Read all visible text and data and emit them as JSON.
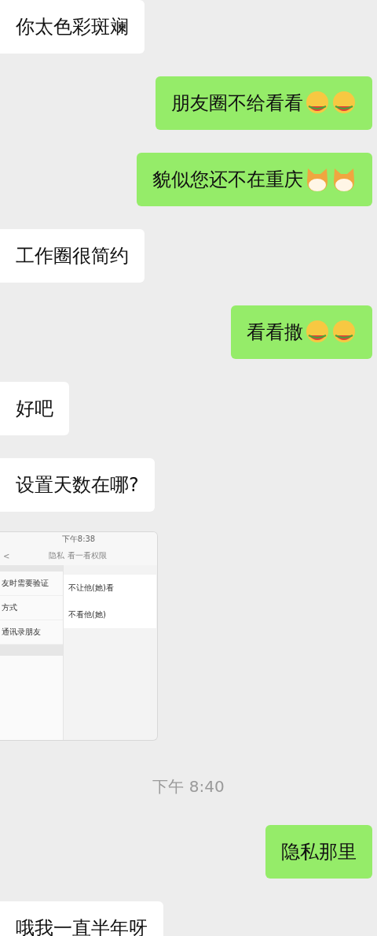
{
  "messages": [
    {
      "kind": "received",
      "text": "你太色彩斑斓"
    },
    {
      "kind": "sent",
      "text": "朋友圈不给看看",
      "stickers": [
        {
          "kind": "melon"
        },
        {
          "kind": "melon"
        }
      ]
    },
    {
      "kind": "sent",
      "text": "貌似您还不在重庆",
      "stickers": [
        {
          "kind": "dog"
        },
        {
          "kind": "dog"
        }
      ]
    },
    {
      "kind": "received",
      "text": "工作圈很简约"
    },
    {
      "kind": "sent",
      "text": "看看撒",
      "stickers": [
        {
          "kind": "melon"
        },
        {
          "kind": "melon"
        }
      ]
    },
    {
      "kind": "received",
      "text": "好吧"
    },
    {
      "kind": "received",
      "text": "设置天数在哪?"
    },
    {
      "kind": "screenshot",
      "status_time": "下午8:38",
      "title": "隐私 看一看权限",
      "back": "<",
      "list": [
        "友时需要验证",
        "方式",
        "通讯录朋友"
      ],
      "menu": [
        "不让他(她)看",
        "不看他(她)"
      ]
    },
    {
      "kind": "time",
      "text": "下午 8:40"
    },
    {
      "kind": "sent",
      "text": "隐私那里"
    },
    {
      "kind": "received",
      "text": "哦我一直半年呀"
    }
  ]
}
